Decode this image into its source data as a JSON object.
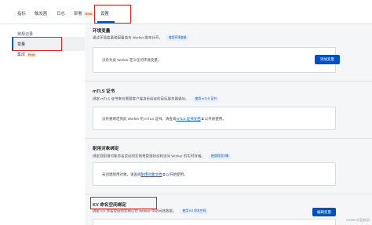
{
  "tabs": [
    {
      "label": "指标"
    },
    {
      "label": "触发器"
    },
    {
      "label": "日志"
    },
    {
      "label": "部署",
      "badge": "Beta"
    },
    {
      "label": "设置"
    }
  ],
  "sidebar": {
    "items": [
      {
        "label": "常规记录"
      },
      {
        "label": "变量"
      },
      {
        "label": "集成",
        "badge": "Beta"
      }
    ]
  },
  "env": {
    "title": "环境变量",
    "desc": "通过环境变量和配置值与 Worker 脚本分开。",
    "doc_link": "使用环境变量",
    "empty_text": "没有为此 Worker 定义任何环境变量。",
    "button": "添加变量"
  },
  "mtls": {
    "title": "mTLS 证书",
    "desc": "绑定 mTLS 证书来与需要客户端身份验证的目标服务器通信。",
    "doc_link": "使用 mTLS 证书",
    "empty_before": "没有要绑定到此 Worker 的 mTLS 证书。请查阅",
    "link": "mTLS 证书文档",
    "empty_after": "以开始使用。"
  },
  "durable": {
    "title": "耐用对象绑定",
    "desc": "绑定到耐用对象命名空间的实例来管理状态和访问 Worker 的实时存储。",
    "doc_link": "使用耐用对象",
    "empty_before": "未创建耐用对象。请查阅",
    "link": "耐用对象文档",
    "empty_after": "以开始使用。"
  },
  "kv": {
    "title": "KV 命名空间绑定",
    "desc": "绑定 KV 命名空间的实例以在 Worker 中访问其数据。",
    "doc_link": "使用 KV 命名空间",
    "button": "编辑变量"
  },
  "watermark": "CSDN @蓝鹤羽",
  "colors": {
    "accent": "#0051c3",
    "highlight": "#e0201c"
  }
}
